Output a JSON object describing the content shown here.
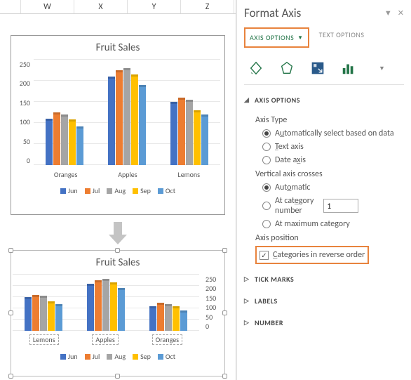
{
  "columns": [
    "W",
    "X",
    "Y",
    "Z"
  ],
  "chart_data": [
    {
      "type": "bar",
      "title": "Fruit Sales",
      "categories": [
        "Oranges",
        "Apples",
        "Lemons"
      ],
      "series": [
        {
          "name": "Jun",
          "values": [
            110,
            210,
            150
          ],
          "color": "#4472c4"
        },
        {
          "name": "Jul",
          "values": [
            125,
            225,
            160
          ],
          "color": "#ed7d31"
        },
        {
          "name": "Aug",
          "values": [
            120,
            230,
            155
          ],
          "color": "#a5a5a5"
        },
        {
          "name": "Sep",
          "values": [
            108,
            215,
            130
          ],
          "color": "#ffc000"
        },
        {
          "name": "Oct",
          "values": [
            92,
            190,
            120
          ],
          "color": "#5b9bd5"
        }
      ],
      "ylim": [
        0,
        250
      ],
      "yticks": [
        0,
        50,
        100,
        150,
        200,
        250
      ]
    },
    {
      "type": "bar",
      "title": "Fruit Sales",
      "categories": [
        "Lemons",
        "Apples",
        "Oranges"
      ],
      "series": [
        {
          "name": "Jun",
          "values": [
            150,
            210,
            110
          ],
          "color": "#4472c4"
        },
        {
          "name": "Jul",
          "values": [
            160,
            225,
            125
          ],
          "color": "#ed7d31"
        },
        {
          "name": "Aug",
          "values": [
            155,
            230,
            120
          ],
          "color": "#a5a5a5"
        },
        {
          "name": "Sep",
          "values": [
            130,
            215,
            108
          ],
          "color": "#ffc000"
        },
        {
          "name": "Oct",
          "values": [
            120,
            190,
            92
          ],
          "color": "#5b9bd5"
        }
      ],
      "ylim": [
        0,
        250
      ],
      "yticks": [
        0,
        50,
        100,
        150,
        200,
        250
      ]
    }
  ],
  "pane": {
    "title": "Format Axis",
    "tab_axis_options": "AXIS OPTIONS",
    "tab_text_options": "TEXT OPTIONS",
    "sections": {
      "axis_options": "AXIS OPTIONS",
      "tick_marks": "TICK MARKS",
      "labels": "LABELS",
      "number": "NUMBER"
    },
    "axis_type_label": "Axis Type",
    "radio_auto": "Automatically select based on data",
    "radio_text": "Text axis",
    "radio_date": "Date axis",
    "vert_crosses_label": "Vertical axis crosses",
    "radio_automatic": "Automatic",
    "radio_at_cat": "At category number",
    "at_cat_value": "1",
    "radio_at_max": "At maximum category",
    "axis_position_label": "Axis position",
    "check_reverse": "Categories in reverse order"
  }
}
